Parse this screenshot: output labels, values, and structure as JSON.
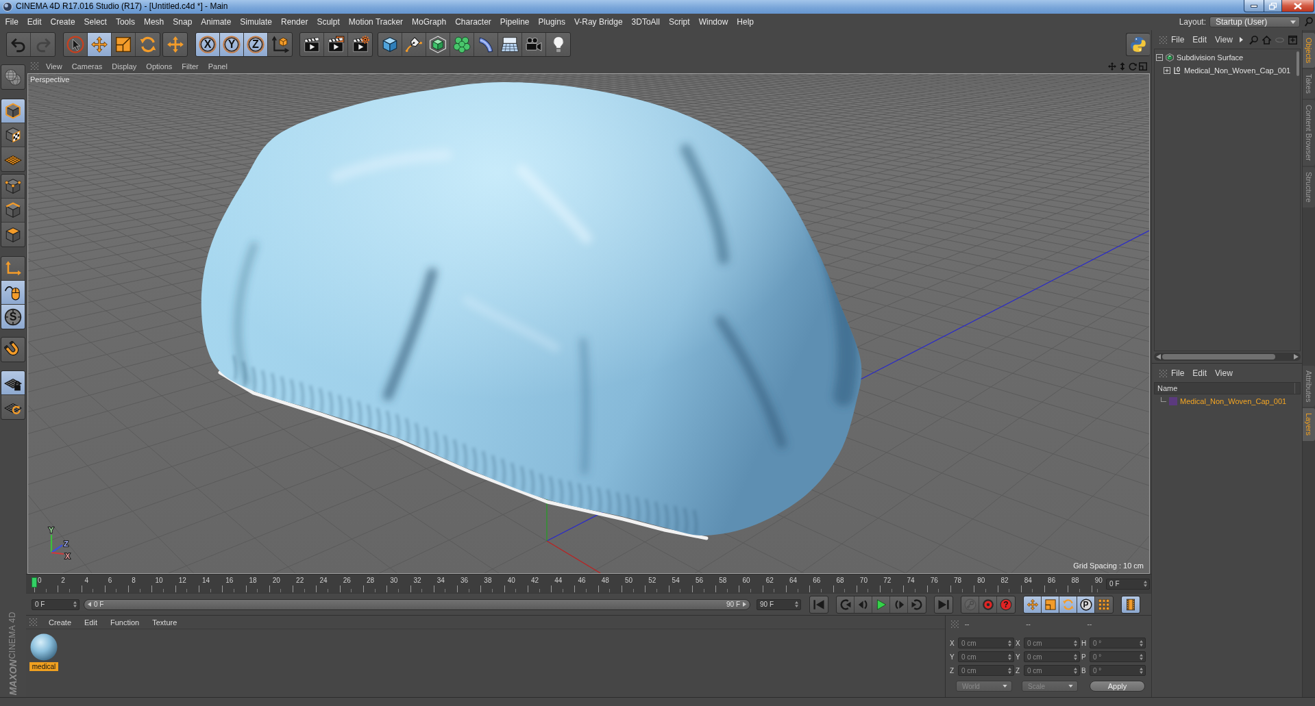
{
  "window": {
    "title": "CINEMA 4D R17.016 Studio (R17) - [Untitled.c4d *] - Main"
  },
  "menu_bar": {
    "items": [
      "File",
      "Edit",
      "Create",
      "Select",
      "Tools",
      "Mesh",
      "Snap",
      "Animate",
      "Simulate",
      "Render",
      "Sculpt",
      "Motion Tracker",
      "MoGraph",
      "Character",
      "Pipeline",
      "Plugins",
      "V-Ray Bridge",
      "3DToAll",
      "Script",
      "Window",
      "Help"
    ],
    "layout_label": "Layout:",
    "layout_value": "Startup (User)"
  },
  "toolbar": {
    "groups": [
      [
        {
          "kind": "undo",
          "selected": false,
          "disabled": false
        },
        {
          "kind": "redo",
          "selected": false,
          "disabled": true
        }
      ],
      [
        {
          "kind": "live-selection",
          "selected": false,
          "disabled": false
        },
        {
          "kind": "move",
          "selected": true,
          "disabled": false
        },
        {
          "kind": "scale",
          "selected": false,
          "disabled": false
        },
        {
          "kind": "rotate",
          "selected": false,
          "disabled": false
        }
      ],
      [
        {
          "kind": "recent-tool",
          "selected": false,
          "disabled": false
        }
      ],
      [
        {
          "kind": "axis-lock",
          "label": "X",
          "selected": true,
          "disabled": false
        },
        {
          "kind": "axis-lock",
          "label": "Y",
          "selected": true,
          "disabled": false
        },
        {
          "kind": "axis-lock",
          "label": "Z",
          "selected": true,
          "disabled": false
        },
        {
          "kind": "coordinate-system",
          "selected": false,
          "disabled": false
        }
      ],
      [
        {
          "kind": "render-view",
          "selected": false,
          "disabled": false
        },
        {
          "kind": "render-picture",
          "selected": false,
          "disabled": false
        },
        {
          "kind": "render-settings",
          "selected": false,
          "disabled": false
        }
      ],
      [
        {
          "kind": "cube",
          "selected": false,
          "disabled": false
        },
        {
          "kind": "pen",
          "selected": false,
          "disabled": false
        },
        {
          "kind": "subdivision",
          "selected": false,
          "disabled": false
        },
        {
          "kind": "cloner",
          "selected": false,
          "disabled": false
        },
        {
          "kind": "bend",
          "selected": false,
          "disabled": false
        },
        {
          "kind": "floor",
          "selected": false,
          "disabled": false
        },
        {
          "kind": "camera",
          "selected": false,
          "disabled": false
        },
        {
          "kind": "light",
          "selected": false,
          "disabled": false
        }
      ]
    ]
  },
  "left_toolbar": {
    "groups": [
      [
        {
          "kind": "scene",
          "selected": false
        }
      ],
      [
        {
          "kind": "model",
          "selected": true
        },
        {
          "kind": "texture",
          "selected": false
        },
        {
          "kind": "workplane",
          "selected": false
        }
      ],
      [
        {
          "kind": "points",
          "selected": false
        },
        {
          "kind": "edges",
          "selected": false
        },
        {
          "kind": "polygons",
          "selected": false
        }
      ],
      [
        {
          "kind": "axis",
          "selected": false
        },
        {
          "kind": "tweak",
          "selected": true
        },
        {
          "kind": "snap",
          "label": "S",
          "selected": true
        }
      ],
      [
        {
          "kind": "magnet",
          "selected": false
        }
      ],
      [
        {
          "kind": "workplane-lock",
          "selected": true
        },
        {
          "kind": "grid-rotate",
          "selected": false
        }
      ]
    ]
  },
  "viewport": {
    "menu": [
      "View",
      "Cameras",
      "Display",
      "Options",
      "Filter",
      "Panel"
    ],
    "camera": "Perspective",
    "grid_spacing": "Grid Spacing : 10 cm",
    "gizmo": [
      {
        "label": "Y",
        "color": "#3cc03c"
      },
      {
        "label": "Z",
        "color": "#3a50e0"
      },
      {
        "label": "X",
        "color": "#d03a3a"
      }
    ]
  },
  "timeline": {
    "ticks": [
      "0",
      "2",
      "4",
      "6",
      "8",
      "10",
      "12",
      "14",
      "16",
      "18",
      "20",
      "22",
      "24",
      "26",
      "28",
      "30",
      "32",
      "34",
      "36",
      "38",
      "40",
      "42",
      "44",
      "46",
      "48",
      "50",
      "52",
      "54",
      "56",
      "58",
      "60",
      "62",
      "64",
      "66",
      "68",
      "70",
      "72",
      "74",
      "76",
      "78",
      "80",
      "82",
      "84",
      "86",
      "88",
      "90"
    ],
    "level": 0,
    "current_frame": "0 F"
  },
  "playback": {
    "start_field": "0 F",
    "range": {
      "start": "0 F",
      "end": "90 F",
      "level": 1
    },
    "end_field": "90 F",
    "button_groups": [
      [
        {
          "kind": "go-start",
          "selected": false,
          "disabled": false
        }
      ],
      [
        {
          "kind": "previous-key",
          "selected": false,
          "disabled": false
        },
        {
          "kind": "step-back",
          "selected": false,
          "disabled": false
        },
        {
          "kind": "play",
          "selected": false,
          "disabled": false
        },
        {
          "kind": "step-forward",
          "selected": false,
          "disabled": false
        },
        {
          "kind": "next-key",
          "selected": false,
          "disabled": false
        }
      ],
      [
        {
          "kind": "go-end",
          "selected": false,
          "disabled": false
        }
      ],
      [
        {
          "kind": "record-objects",
          "selected": false,
          "disabled": true
        },
        {
          "kind": "auto-key",
          "selected": false,
          "disabled": false
        },
        {
          "kind": "key-selection",
          "label": "?",
          "selected": false,
          "disabled": false
        }
      ],
      [
        {
          "kind": "key-position",
          "selected": true,
          "disabled": false
        },
        {
          "kind": "key-scale",
          "selected": true,
          "disabled": false
        },
        {
          "kind": "key-rotation",
          "selected": true,
          "disabled": false
        },
        {
          "kind": "key-parameter",
          "label": "P",
          "selected": true,
          "disabled": false
        },
        {
          "kind": "key-point-level",
          "selected": false,
          "disabled": false
        }
      ],
      [
        {
          "kind": "timeline-window",
          "selected": true,
          "disabled": false
        }
      ]
    ]
  },
  "material_manager": {
    "menu": [
      "Create",
      "Edit",
      "Function",
      "Texture"
    ],
    "materials": [
      {
        "name": "medical",
        "selected": true
      }
    ]
  },
  "coordinates": {
    "headers": [
      "--",
      "--",
      "--"
    ],
    "rows": [
      [
        {
          "label": "X",
          "value": "0 cm"
        },
        {
          "label": "X",
          "value": "0 cm"
        },
        {
          "label": "H",
          "value": "0 °"
        }
      ],
      [
        {
          "label": "Y",
          "value": "0 cm"
        },
        {
          "label": "Y",
          "value": "0 cm"
        },
        {
          "label": "P",
          "value": "0 °"
        }
      ],
      [
        {
          "label": "Z",
          "value": "0 cm"
        },
        {
          "label": "Z",
          "value": "0 cm"
        },
        {
          "label": "B",
          "value": "0 °"
        }
      ]
    ],
    "dropdowns": [
      {
        "value": "World",
        "disabled": true
      },
      {
        "value": "Scale",
        "disabled": true
      }
    ],
    "apply": "Apply"
  },
  "object_manager": {
    "menu": [
      "File",
      "Edit",
      "View"
    ],
    "tree": [
      {
        "name": "Subdivision Surface",
        "kind": "subdivision",
        "expanded": true,
        "children": [
          {
            "name": "Medical_Non_Woven_Cap_001",
            "kind": "null",
            "expanded": false
          }
        ]
      }
    ]
  },
  "layer_manager": {
    "menu": [
      "File",
      "Edit",
      "View"
    ],
    "column": "Name",
    "layers": [
      {
        "name": "Medical_Non_Woven_Cap_001",
        "color": "#5b3a7e",
        "selected": true
      }
    ]
  },
  "side_tabs": {
    "top": [
      {
        "label": "Objects",
        "selected": true
      },
      {
        "label": "Takes",
        "selected": false
      },
      {
        "label": "Content Browser",
        "selected": false
      },
      {
        "label": "Structure",
        "selected": false
      }
    ],
    "bottom": [
      {
        "label": "Attributes",
        "selected": false
      },
      {
        "label": "Layers",
        "selected": true
      }
    ]
  },
  "logo": {
    "brand": "MAXON",
    "product": "CINEMA 4D"
  }
}
